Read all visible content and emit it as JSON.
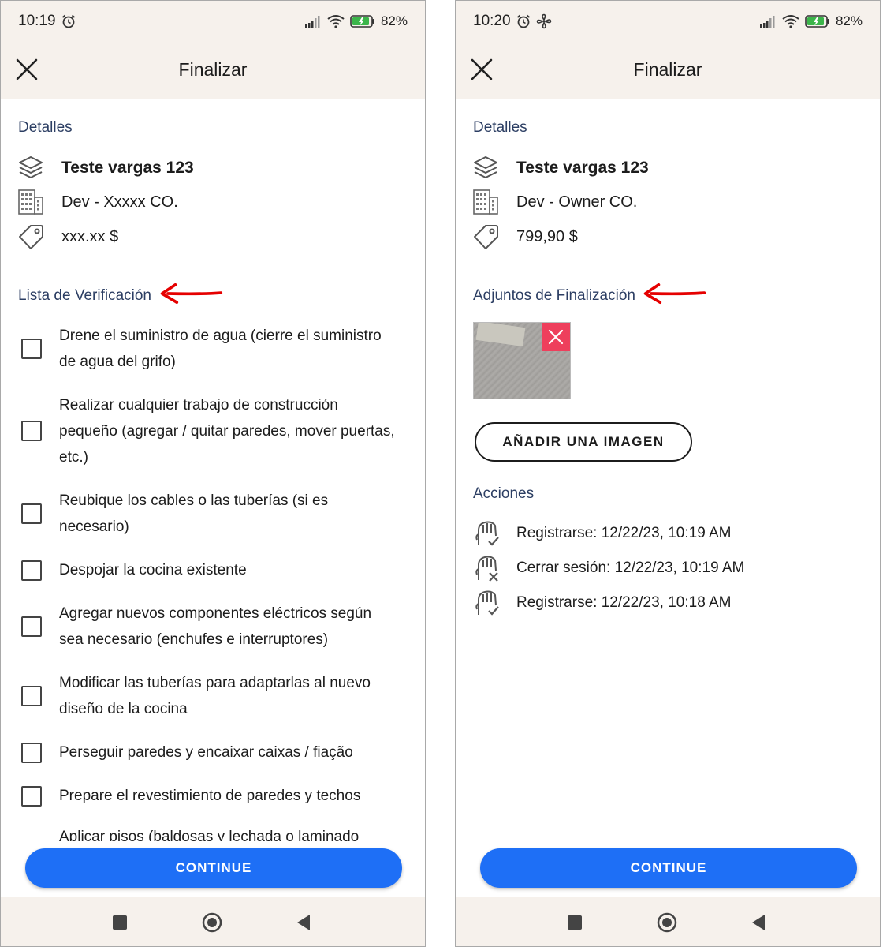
{
  "left": {
    "status": {
      "time": "10:19",
      "battery": "82%"
    },
    "header": {
      "title": "Finalizar"
    },
    "details": {
      "label": "Detalles",
      "title": "Teste vargas 123",
      "company": "Dev - Xxxxx CO.",
      "price": "xxx.xx  $"
    },
    "checklist": {
      "label": "Lista de Verificación",
      "items": [
        "Drene el suministro de agua (cierre el suministro de agua del grifo)",
        "Realizar cualquier trabajo de construcción pequeño (agregar / quitar paredes, mover puertas, etc.)",
        "Reubique los cables o las tuberías (si es necesario)",
        "Despojar la cocina existente",
        "Agregar nuevos componentes eléctricos según sea necesario (enchufes e interruptores)",
        "Modificar las tuberías para adaptarlas al nuevo diseño de la cocina",
        "Perseguir paredes y encaixar caixas / fiação",
        "Prepare el revestimiento de paredes y techos",
        "Aplicar pisos (baldosas y lechada o laminado"
      ]
    },
    "continue_label": "CONTINUE"
  },
  "right": {
    "status": {
      "time": "10:20",
      "battery": "82%"
    },
    "header": {
      "title": "Finalizar"
    },
    "details": {
      "label": "Detalles",
      "title": "Teste vargas 123",
      "company": "Dev - Owner CO.",
      "price": "799,90 $"
    },
    "attachments": {
      "label": "Adjuntos de Finalización",
      "add_label": "AÑADIR UNA IMAGEN"
    },
    "actions": {
      "label": "Acciones",
      "items": [
        {
          "text": "Registrarse: 12/22/23, 10:19 AM",
          "icon": "clock-in-icon"
        },
        {
          "text": "Cerrar sesión: 12/22/23, 10:19 AM",
          "icon": "clock-out-icon"
        },
        {
          "text": "Registrarse: 12/22/23, 10:18 AM",
          "icon": "clock-in-icon"
        }
      ]
    },
    "continue_label": "CONTINUE"
  },
  "colors": {
    "primary": "#1e6ff6",
    "section_label": "#2c3e63",
    "header_bg": "#f6f1ec",
    "delete": "#ee3f5c",
    "annotation": "#e50000"
  }
}
